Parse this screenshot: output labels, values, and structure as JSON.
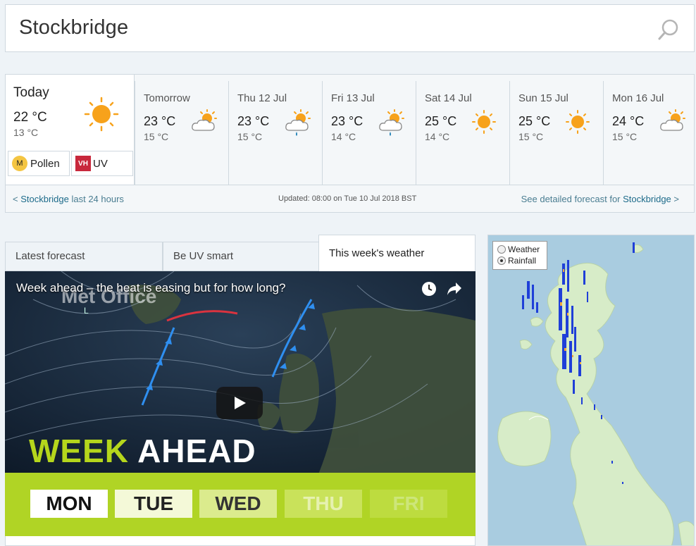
{
  "search": {
    "value": "Stockbridge",
    "icon": "search-icon"
  },
  "today": {
    "title": "Today",
    "high": "22 °C",
    "low": "13 °C",
    "icon": "sun-icon",
    "pollen": {
      "badge": "M",
      "label": "Pollen",
      "color": "#f4c542"
    },
    "uv": {
      "badge": "VH",
      "label": "UV",
      "color": "#c8283c"
    }
  },
  "days": [
    {
      "name": "Tomorrow",
      "high": "23 °C",
      "low": "15 °C",
      "icon": "sun-cloud-icon"
    },
    {
      "name": "Thu 12 Jul",
      "high": "23 °C",
      "low": "15 °C",
      "icon": "sun-cloud-rain-icon"
    },
    {
      "name": "Fri 13 Jul",
      "high": "23 °C",
      "low": "14 °C",
      "icon": "sun-cloud-rain-icon"
    },
    {
      "name": "Sat 14 Jul",
      "high": "25 °C",
      "low": "14 °C",
      "icon": "sun-icon"
    },
    {
      "name": "Sun 15 Jul",
      "high": "25 °C",
      "low": "15 °C",
      "icon": "sun-icon"
    },
    {
      "name": "Mon 16 Jul",
      "high": "24 °C",
      "low": "15 °C",
      "icon": "sun-cloud-icon"
    }
  ],
  "footer": {
    "left_prefix": "< ",
    "left_place": "Stockbridge",
    "left_suffix": " last 24 hours",
    "updated": "Updated: 08:00 on Tue 10 Jul 2018 BST",
    "right_prefix": "See detailed forecast for ",
    "right_place": "Stockbridge",
    "right_suffix": " >"
  },
  "tabs": [
    {
      "label": "Latest forecast",
      "active": false
    },
    {
      "label": "Be UV smart",
      "active": false
    },
    {
      "label": "This week's weather",
      "active": true
    }
  ],
  "video": {
    "title": "Week ahead – the heat is easing but for how long?",
    "brand": "Met Office",
    "banner_word1": "WEEK",
    "banner_word2": "AHEAD",
    "days": [
      "MON",
      "TUE",
      "WED",
      "THU",
      "FRI"
    ]
  },
  "map": {
    "options": [
      {
        "label": "Weather",
        "selected": false
      },
      {
        "label": "Rainfall",
        "selected": true
      }
    ]
  },
  "colors": {
    "accent_link": "#1d6b8a",
    "sun": "#f7a21b",
    "banner_green": "#b0d425"
  }
}
